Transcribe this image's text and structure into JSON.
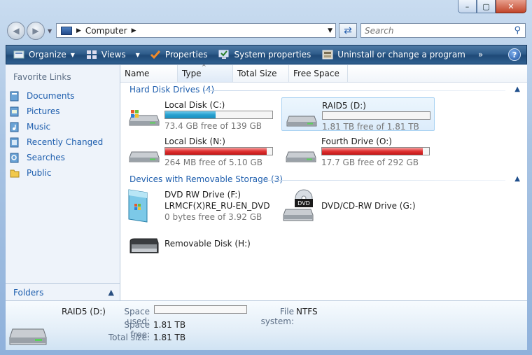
{
  "window": {
    "controls": {
      "minimize": "–",
      "maximize": "▢",
      "close": "✕"
    }
  },
  "nav": {
    "back_icon": "back-arrow-icon",
    "forward_icon": "forward-arrow-icon",
    "address_text": "Computer",
    "search_placeholder": "Search"
  },
  "toolbar": {
    "organize": "Organize",
    "views": "Views",
    "properties": "Properties",
    "system_properties": "System properties",
    "uninstall": "Uninstall or change a program",
    "more": "»",
    "help": "?"
  },
  "sidebar": {
    "title": "Favorite Links",
    "items": [
      {
        "label": "Documents",
        "icon": "documents-icon"
      },
      {
        "label": "Pictures",
        "icon": "pictures-icon"
      },
      {
        "label": "Music",
        "icon": "music-icon"
      },
      {
        "label": "Recently Changed",
        "icon": "recently-changed-icon"
      },
      {
        "label": "Searches",
        "icon": "searches-icon"
      },
      {
        "label": "Public",
        "icon": "public-folder-icon"
      }
    ],
    "folders_label": "Folders"
  },
  "columns": [
    "Name",
    "Type",
    "Total Size",
    "Free Space"
  ],
  "groups": {
    "hard_disks": {
      "title": "Hard Disk Drives (4)",
      "drives": [
        {
          "name": "Local Disk (C:)",
          "free": "73.4 GB free of 139 GB",
          "used_fraction": 0.47,
          "bar_color": "blue"
        },
        {
          "name": "RAID5 (D:)",
          "free": "1.81 TB free of 1.81 TB",
          "used_fraction": 0.0,
          "bar_color": "blue"
        },
        {
          "name": "Local Disk (N:)",
          "free": "264 MB free of 5.10 GB",
          "used_fraction": 0.95,
          "bar_color": "red"
        },
        {
          "name": "Fourth Drive (O:)",
          "free": "17.7 GB free of 292 GB",
          "used_fraction": 0.94,
          "bar_color": "red"
        }
      ]
    },
    "removable": {
      "title": "Devices with Removable Storage (3)",
      "dvd_rw": {
        "name": "DVD RW Drive (F:)",
        "label": "LRMCF(X)RE_RU-EN_DVD",
        "free": "0 bytes free of 3.92 GB"
      },
      "dvd_cd": {
        "name": "DVD/CD-RW Drive (G:)",
        "badge": "DVD"
      },
      "removable_disk": {
        "name": "Removable Disk (H:)"
      }
    }
  },
  "details": {
    "name": "RAID5 (D:)",
    "space_used_label": "Space used:",
    "space_free_label": "Space free:",
    "space_free": "1.81 TB",
    "total_size_label": "Total size:",
    "total_size": "1.81 TB",
    "fs_label": "File system:",
    "fs": "NTFS"
  }
}
